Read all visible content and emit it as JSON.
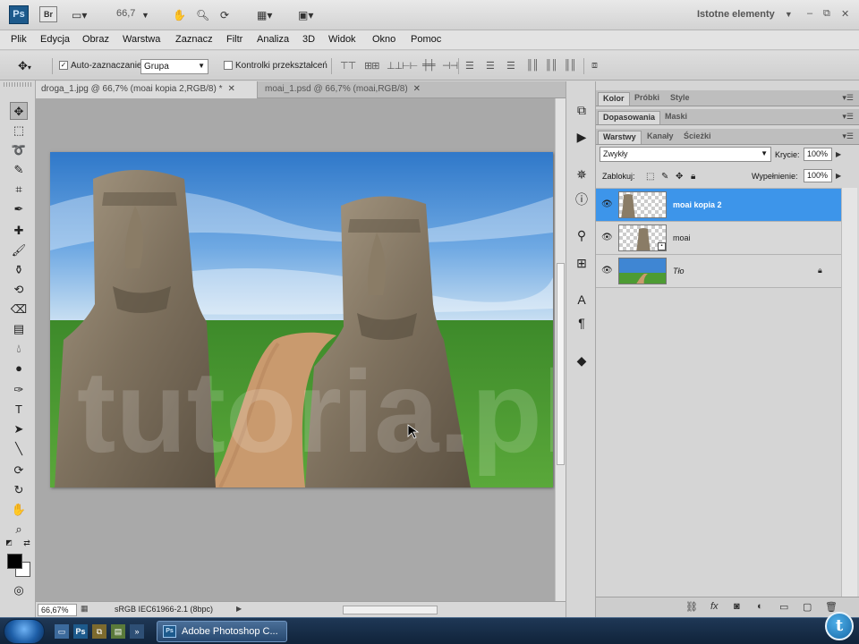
{
  "app": {
    "logo": "Ps",
    "bridge": "Br",
    "zoom": "66,7",
    "workspace": "Istotne elementy",
    "controls": {
      "minimize": "–",
      "restore": "⧉",
      "close": "✕"
    }
  },
  "menu": [
    "Plik",
    "Edycja",
    "Obraz",
    "Warstwa",
    "Zaznacz",
    "Filtr",
    "Analiza",
    "3D",
    "Widok",
    "Okno",
    "Pomoc"
  ],
  "options": {
    "auto_select_label": "Auto-zaznaczanie:",
    "auto_select_value": "Grupa",
    "transform_controls_label": "Kontrolki przekształceń"
  },
  "tabs": [
    {
      "label": "droga_1.jpg @ 66,7% (moai kopia 2,RGB/8) *",
      "close": "✕"
    },
    {
      "label": "moai_1.psd @ 66,7% (moai,RGB/8)",
      "close": "✕"
    }
  ],
  "status": {
    "zoom": "66,67%",
    "profile": "sRGB IEC61966-2.1 (8bpc)"
  },
  "panels": {
    "top_tabs": [
      "Kolor",
      "Próbki",
      "Style"
    ],
    "mid_tabs": [
      "Dopasowania",
      "Maski"
    ],
    "layer_tabs": [
      "Warstwy",
      "Kanały",
      "Ścieżki"
    ],
    "blend_mode": "Zwykły",
    "opacity_label": "Krycie:",
    "opacity_value": "100%",
    "lock_label": "Zablokuj:",
    "fill_label": "Wypełnienie:",
    "fill_value": "100%"
  },
  "layers": [
    {
      "name": "moai kopia 2",
      "selected": true
    },
    {
      "name": "moai",
      "selected": false
    },
    {
      "name": "Tło",
      "selected": false
    }
  ],
  "taskbar": {
    "app_button": "Adobe Photoshop C...",
    "badge": "t"
  },
  "watermark": "tutoria.pl",
  "colors": {
    "selection": "#3d95ea",
    "foreground": "#000000",
    "background": "#ffffff",
    "ps_blue": "#1d5a8c"
  }
}
